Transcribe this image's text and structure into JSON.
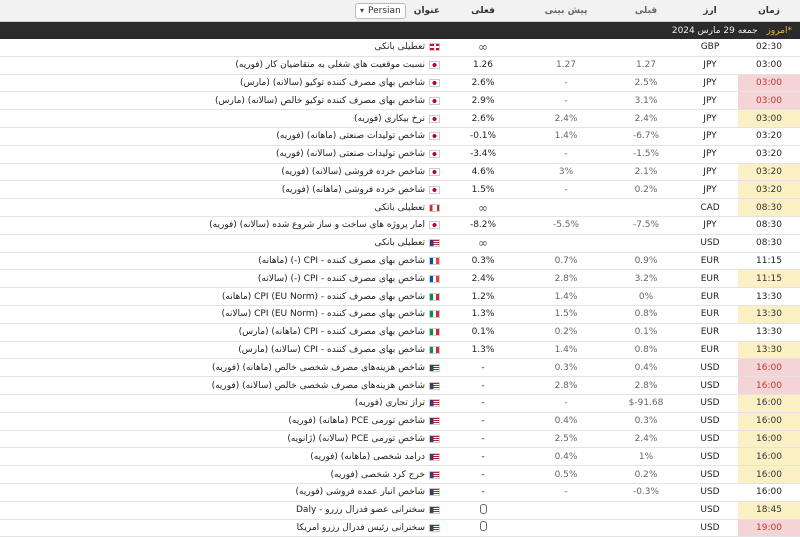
{
  "header": {
    "time": "زمان",
    "currency": "ارز",
    "previous": "قبلی",
    "forecast": "پیش بینی",
    "actual": "فعلی",
    "title": "عنوان",
    "language": "Persian"
  },
  "day": {
    "today": "*امروز",
    "date": "جمعه 29 مارس 2024"
  },
  "rows": [
    {
      "time": "02:30",
      "tstyle": "",
      "cur": "GBP",
      "prev": "",
      "fc": "",
      "act": "∞",
      "flag": "uk",
      "title": "تعطیلی بانکی",
      "icon": "holiday"
    },
    {
      "time": "03:00",
      "tstyle": "",
      "cur": "JPY",
      "prev": "1.27",
      "fc": "1.27",
      "act": "1.26",
      "flag": "jp",
      "title": "نسبت موقعیت های شغلی به متقاضیان کار (فوریه)"
    },
    {
      "time": "03:00",
      "tstyle": "red",
      "cur": "JPY",
      "prev": "2.5%",
      "fc": "-",
      "act": "2.6%",
      "flag": "jp",
      "title": "شاخص بهای مصرف کننده توکیو (سالانه) (مارس)"
    },
    {
      "time": "03:00",
      "tstyle": "red",
      "cur": "JPY",
      "prev": "3.1%",
      "fc": "-",
      "act": "2.9%",
      "flag": "jp",
      "title": "شاخص بهای مصرف کننده توکیو خالص (سالانه) (مارس)"
    },
    {
      "time": "03:00",
      "tstyle": "yellow",
      "cur": "JPY",
      "prev": "2.4%",
      "fc": "2.4%",
      "act": "2.6%",
      "flag": "jp",
      "title": "نرخ بیکاری (فوریه)"
    },
    {
      "time": "03:20",
      "tstyle": "",
      "cur": "JPY",
      "prev": "6.7%-",
      "fc": "1.4%",
      "act": "0.1%-",
      "flag": "jp",
      "title": "شاخص تولیدات صنعتی (ماهانه) (فوریه)"
    },
    {
      "time": "03:20",
      "tstyle": "",
      "cur": "JPY",
      "prev": "1.5%-",
      "fc": "-",
      "act": "3.4%-",
      "flag": "jp",
      "title": "شاخص تولیدات صنعتی (سالانه) (فوریه)"
    },
    {
      "time": "03:20",
      "tstyle": "yellow",
      "cur": "JPY",
      "prev": "2.1%",
      "fc": "3%",
      "act": "4.6%",
      "flag": "jp",
      "title": "شاخص خرده فروشی (سالانه) (فوریه)"
    },
    {
      "time": "03:20",
      "tstyle": "yellow",
      "cur": "JPY",
      "prev": "0.2%",
      "fc": "-",
      "act": "1.5%",
      "flag": "jp",
      "title": "شاخص خرده فروشی (ماهانه) (فوریه)"
    },
    {
      "time": "08:30",
      "tstyle": "yellow",
      "cur": "CAD",
      "prev": "",
      "fc": "",
      "act": "∞",
      "flag": "ca",
      "title": "تعطیلی بانکی",
      "icon": "holiday"
    },
    {
      "time": "08:30",
      "tstyle": "",
      "cur": "JPY",
      "prev": "7.5%-",
      "fc": "5.5%-",
      "act": "8.2%-",
      "flag": "jp",
      "title": "آمار پروژه های ساخت و ساز شروع شده (سالانه) (فوریه)"
    },
    {
      "time": "08:30",
      "tstyle": "",
      "cur": "USD",
      "prev": "",
      "fc": "",
      "act": "∞",
      "flag": "us",
      "title": "تعطیلی بانکی",
      "icon": "holiday"
    },
    {
      "time": "11:15",
      "tstyle": "",
      "cur": "EUR",
      "prev": "0.9%",
      "fc": "0.7%",
      "act": "0.3%",
      "flag": "fr",
      "title": "شاخص بهای مصرف کننده - CPI (-) (ماهانه)"
    },
    {
      "time": "11:15",
      "tstyle": "yellow",
      "cur": "EUR",
      "prev": "3.2%",
      "fc": "2.8%",
      "act": "2.4%",
      "flag": "fr",
      "title": "شاخص بهای مصرف کننده - CPI (-) (سالانه)"
    },
    {
      "time": "13:30",
      "tstyle": "",
      "cur": "EUR",
      "prev": "0%",
      "fc": "1.4%",
      "act": "1.2%",
      "flag": "it",
      "title": "شاخص بهای مصرف کننده - (CPI (EU Norm (ماهانه)"
    },
    {
      "time": "13:30",
      "tstyle": "yellow",
      "cur": "EUR",
      "prev": "0.8%",
      "fc": "1.5%",
      "act": "1.3%",
      "flag": "it",
      "title": "شاخص بهای مصرف کننده - (CPI (EU Norm (سالانه)"
    },
    {
      "time": "13:30",
      "tstyle": "",
      "cur": "EUR",
      "prev": "0.1%",
      "fc": "0.2%",
      "act": "0.1%",
      "flag": "it",
      "title": "شاخص بهای مصرف کننده - CPI (ماهانه) (مارس)"
    },
    {
      "time": "13:30",
      "tstyle": "yellow",
      "cur": "EUR",
      "prev": "0.8%",
      "fc": "1.4%",
      "act": "1.3%",
      "flag": "it",
      "title": "شاخص بهای مصرف کننده - CPI (سالانه) (مارس)"
    },
    {
      "time": "16:00",
      "tstyle": "red",
      "cur": "USD",
      "prev": "0.4%",
      "fc": "0.3%",
      "act": "-",
      "flag": "us",
      "title": "شاخص هزینه‌های مصرف شخصی خالص (ماهانه) (فوریه)"
    },
    {
      "time": "16:00",
      "tstyle": "red",
      "cur": "USD",
      "prev": "2.8%",
      "fc": "2.8%",
      "act": "-",
      "flag": "us",
      "title": "شاخص هزینه‌های مصرف شخصی خالص (سالانه) (فوریه)"
    },
    {
      "time": "16:00",
      "tstyle": "yellow",
      "cur": "USD",
      "prev": "91.68-$",
      "fc": "-",
      "act": "-",
      "flag": "us",
      "title": "تراز تجاری (فوریه)"
    },
    {
      "time": "16:00",
      "tstyle": "yellow",
      "cur": "USD",
      "prev": "0.3%",
      "fc": "0.4%",
      "act": "-",
      "flag": "us",
      "title": "شاخص تورمی PCE (ماهانه) (فوریه)"
    },
    {
      "time": "16:00",
      "tstyle": "yellow",
      "cur": "USD",
      "prev": "2.4%",
      "fc": "2.5%",
      "act": "-",
      "flag": "us",
      "title": "شاخص تورمی PCE (سالانه) (ژانویه)"
    },
    {
      "time": "16:00",
      "tstyle": "yellow",
      "cur": "USD",
      "prev": "1%",
      "fc": "0.4%",
      "act": "-",
      "flag": "us",
      "title": "درآمد شخصی (ماهانه) (فوریه)"
    },
    {
      "time": "16:00",
      "tstyle": "yellow",
      "cur": "USD",
      "prev": "0.2%",
      "fc": "0.5%",
      "act": "-",
      "flag": "us",
      "title": "خرج کرد شخصی (فوریه)"
    },
    {
      "time": "16:00",
      "tstyle": "",
      "cur": "USD",
      "prev": "0.3%-",
      "fc": "-",
      "act": "-",
      "flag": "us",
      "title": "شاخص انبار عمده فروشی (فوریه)"
    },
    {
      "time": "18:45",
      "tstyle": "yellow",
      "cur": "USD",
      "prev": "",
      "fc": "",
      "act": "",
      "flag": "us",
      "title": "سخنرانی عضو فدرال رزرو - Daly",
      "icon": "mic"
    },
    {
      "time": "19:00",
      "tstyle": "red",
      "cur": "USD",
      "prev": "",
      "fc": "",
      "act": "",
      "flag": "us",
      "title": "سخنرانی رئیس فدرال رزرو آمریکا",
      "icon": "mic"
    }
  ]
}
